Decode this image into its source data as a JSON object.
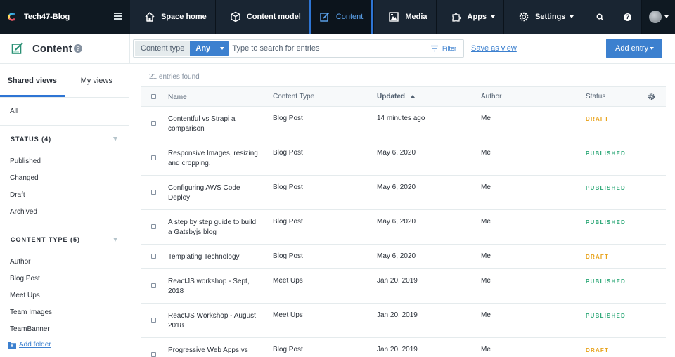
{
  "space": {
    "name": "Tech47-Blog"
  },
  "nav": {
    "items": [
      {
        "label": "Space home",
        "icon": "home-icon"
      },
      {
        "label": "Content model",
        "icon": "cube-icon"
      },
      {
        "label": "Content",
        "icon": "content-icon",
        "active": true
      },
      {
        "label": "Media",
        "icon": "media-icon"
      },
      {
        "label": "Apps",
        "icon": "puzzle-icon",
        "dropdown": true
      },
      {
        "label": "Settings",
        "icon": "gear-icon",
        "dropdown": true
      }
    ],
    "right_icons": [
      "search-icon",
      "help-icon",
      "avatar"
    ]
  },
  "header": {
    "title": "Content",
    "help": "?",
    "search": {
      "content_type_label": "Content type",
      "content_type_value": "Any",
      "placeholder": "Type to search for entries",
      "value": ""
    },
    "filter_label": "Filter",
    "save_as_view": "Save as view",
    "add_entry": "Add entry"
  },
  "sidebar": {
    "tabs": [
      {
        "label": "Shared views",
        "active": true
      },
      {
        "label": "My views",
        "active": false
      }
    ],
    "all_label": "All",
    "status_heading": "STATUS (4)",
    "status_items": [
      "Published",
      "Changed",
      "Draft",
      "Archived"
    ],
    "content_type_heading": "CONTENT TYPE (5)",
    "content_type_items": [
      "Author",
      "Blog Post",
      "Meet Ups",
      "Team Images",
      "TeamBanner"
    ],
    "add_folder": "Add folder"
  },
  "table": {
    "found": "21 entries found",
    "columns": {
      "name": "Name",
      "type": "Content Type",
      "updated": "Updated",
      "author": "Author",
      "status": "Status"
    },
    "rows": [
      {
        "name": "Contentful vs Strapi a comparison",
        "type": "Blog Post",
        "updated": "14 minutes ago",
        "author": "Me",
        "status": "DRAFT"
      },
      {
        "name": "Responsive Images, resizing and cropping.",
        "type": "Blog Post",
        "updated": "May 6, 2020",
        "author": "Me",
        "status": "PUBLISHED"
      },
      {
        "name": "Configuring AWS Code Deploy",
        "type": "Blog Post",
        "updated": "May 6, 2020",
        "author": "Me",
        "status": "PUBLISHED"
      },
      {
        "name": "A step by step guide to build a Gatsbyjs blog",
        "type": "Blog Post",
        "updated": "May 6, 2020",
        "author": "Me",
        "status": "PUBLISHED"
      },
      {
        "name": "Templating Technology",
        "type": "Blog Post",
        "updated": "May 6, 2020",
        "author": "Me",
        "status": "DRAFT"
      },
      {
        "name": "ReactJS workshop - Sept, 2018",
        "type": "Meet Ups",
        "updated": "Jan 20, 2019",
        "author": "Me",
        "status": "PUBLISHED"
      },
      {
        "name": "ReactJS Workshop - August 2018",
        "type": "Meet Ups",
        "updated": "Jan 20, 2019",
        "author": "Me",
        "status": "PUBLISHED"
      },
      {
        "name": "Progressive Web Apps vs",
        "type": "Blog Post",
        "updated": "Jan 20, 2019",
        "author": "Me",
        "status": "DRAFT"
      }
    ]
  },
  "colors": {
    "nav_bg": "#192532",
    "accent": "#3c80cf",
    "draft": "#e8a21a",
    "published": "#2ea878"
  }
}
